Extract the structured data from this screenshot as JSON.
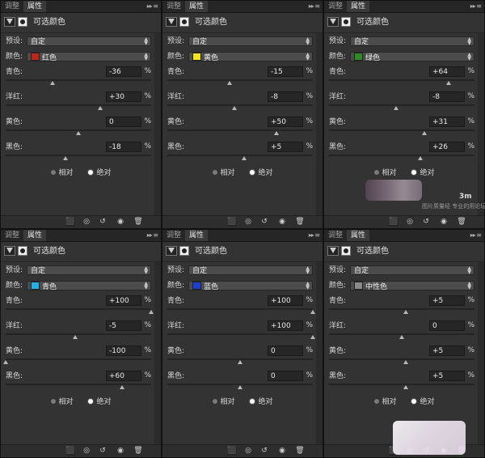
{
  "common": {
    "tab_adjust": "调整",
    "tab_props": "属性",
    "title": "可选颜色",
    "preset_label": "预设:",
    "preset_value": "自定",
    "colors_label": "颜色:",
    "cyan_label": "青色:",
    "magenta_label": "洋红:",
    "yellow_label": "黄色:",
    "black_label": "黑色:",
    "percent": "%",
    "relative_label": "相对",
    "absolute_label": "绝对",
    "method_selected": "absolute"
  },
  "panels": [
    {
      "color_name": "红色",
      "swatch": "#c0241c",
      "cyan": "-36",
      "magenta": "+30",
      "yellow": "0",
      "black": "-18"
    },
    {
      "color_name": "黄色",
      "swatch": "#f4e21a",
      "cyan": "-15",
      "magenta": "-8",
      "yellow": "+50",
      "black": "+5"
    },
    {
      "color_name": "绿色",
      "swatch": "#2f8a23",
      "cyan": "+64",
      "magenta": "-8",
      "yellow": "+31",
      "black": "+26"
    },
    {
      "color_name": "青色",
      "swatch": "#25aee2",
      "cyan": "+100",
      "magenta": "-5",
      "yellow": "-100",
      "black": "+60"
    },
    {
      "color_name": "蓝色",
      "swatch": "#1d3fd1",
      "cyan": "+100",
      "magenta": "+100",
      "yellow": "0",
      "black": "0"
    },
    {
      "color_name": "中性色",
      "swatch": "#8a8a8a",
      "cyan": "+5",
      "magenta": "0",
      "yellow": "+5",
      "black": "+5"
    }
  ],
  "watermark": {
    "logo": "3m",
    "caption": "图片质量经  专业的用论坛"
  },
  "icons": {
    "collapse": "double-chevron-right-icon",
    "menu": "panel-menu-icon",
    "clip": "clip-to-layer-icon",
    "view_previous": "view-previous-state-icon",
    "reset": "reset-icon",
    "visibility": "eye-icon",
    "delete": "trash-icon"
  }
}
